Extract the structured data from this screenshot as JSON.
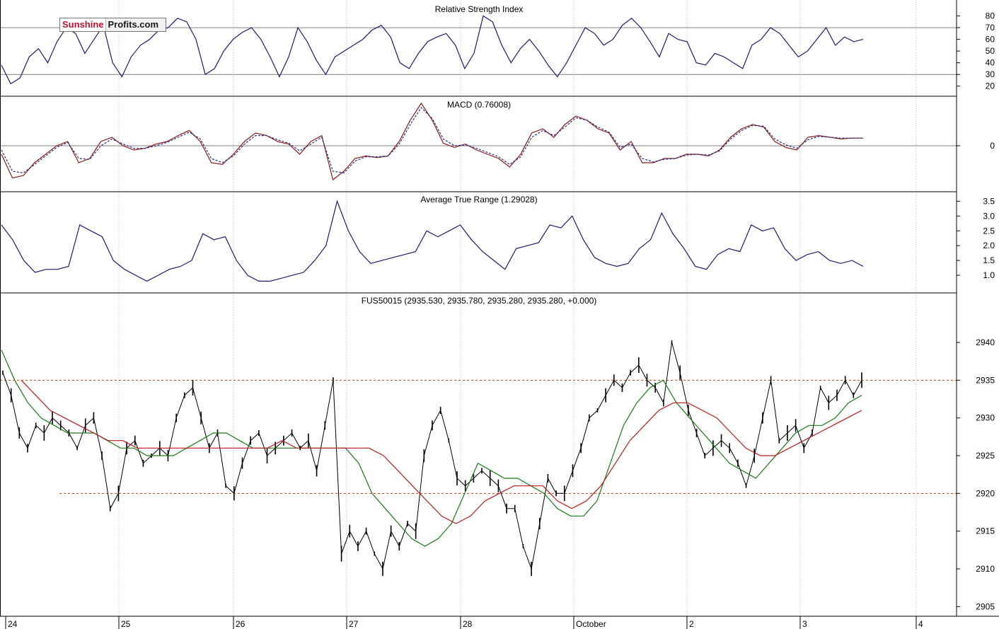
{
  "logo": {
    "part1": "Sunshine",
    "part2": "Profits.com"
  },
  "x_axis_labels": [
    "24",
    "25",
    "26",
    "27",
    "28",
    "October",
    "2",
    "3",
    "4"
  ],
  "chart_data": [
    {
      "type": "line",
      "title": "Relative Strength Index",
      "yticks": [
        "80",
        "70",
        "60",
        "50",
        "40",
        "30",
        "20"
      ],
      "ylim": [
        15,
        90
      ],
      "reference_lines": [
        30,
        70
      ],
      "series": [
        {
          "color": "#1c1c6e",
          "values": [
            38,
            22,
            27,
            45,
            52,
            40,
            58,
            70,
            65,
            48,
            60,
            72,
            40,
            28,
            45,
            55,
            60,
            68,
            70,
            78,
            75,
            60,
            30,
            35,
            50,
            60,
            66,
            70,
            60,
            45,
            28,
            45,
            70,
            58,
            42,
            30,
            45,
            50,
            55,
            60,
            68,
            72,
            62,
            40,
            35,
            48,
            58,
            62,
            65,
            55,
            35,
            48,
            80,
            75,
            55,
            40,
            52,
            60,
            50,
            38,
            28,
            40,
            55,
            70,
            65,
            55,
            60,
            72,
            78,
            70,
            58,
            45,
            65,
            60,
            58,
            40,
            38,
            48,
            45,
            40,
            35,
            55,
            60,
            70,
            65,
            55,
            45,
            50,
            60,
            70,
            55,
            62,
            58,
            60
          ]
        }
      ]
    },
    {
      "type": "line",
      "title": "MACD (0.76008)",
      "yticks": [
        "0"
      ],
      "ylim": [
        -5,
        5.5
      ],
      "series": [
        {
          "color": "#8b1a1a",
          "values": [
            -1,
            -3.8,
            -3.5,
            -2,
            -1,
            0,
            0.5,
            -2,
            -1.5,
            0.5,
            1,
            0,
            -0.5,
            -0.3,
            0.2,
            0.5,
            1.2,
            1.8,
            0.5,
            -2,
            -2.2,
            -1,
            0.5,
            1.5,
            1.2,
            0.5,
            0.2,
            -1,
            0.5,
            1.2,
            -4,
            -3,
            -1.5,
            -1.2,
            -1.4,
            -1.2,
            0.5,
            3,
            5,
            3,
            0.3,
            -0.2,
            0.2,
            -0.5,
            -1,
            -1.5,
            -2.5,
            -1,
            1.5,
            2,
            1,
            2.5,
            3.5,
            3,
            2,
            1.5,
            -0.5,
            0.5,
            -2,
            -2,
            -1.5,
            -1.5,
            -1,
            -1,
            -1.2,
            -0.5,
            1,
            2,
            2.5,
            2.2,
            0.5,
            -0.2,
            -0.5,
            1,
            1.2,
            1,
            0.8,
            0.9,
            0.9
          ]
        },
        {
          "color": "#2a2a8a",
          "values": [
            -0.5,
            -3,
            -3.2,
            -2.2,
            -1.2,
            -0.2,
            0.4,
            -1.5,
            -1.6,
            0,
            0.8,
            0.2,
            -0.3,
            -0.3,
            0,
            0.4,
            1,
            1.6,
            0.8,
            -1.5,
            -2,
            -1.2,
            0.2,
            1.2,
            1.2,
            0.7,
            0.3,
            -0.6,
            0.2,
            1,
            -3,
            -3.2,
            -1.8,
            -1.3,
            -1.3,
            -1.2,
            0.2,
            2.5,
            4.5,
            3.2,
            0.8,
            0,
            0.1,
            -0.3,
            -0.8,
            -1.3,
            -2.2,
            -1.3,
            1,
            1.8,
            1.2,
            2.2,
            3.3,
            3,
            2.2,
            1.6,
            -0.2,
            0.2,
            -1.5,
            -1.9,
            -1.6,
            -1.5,
            -1.1,
            -1,
            -1.1,
            -0.6,
            0.8,
            1.8,
            2.4,
            2.3,
            0.8,
            0.1,
            -0.3,
            0.7,
            1.1,
            1,
            0.9,
            0.9,
            0.9
          ]
        }
      ]
    },
    {
      "type": "line",
      "title": "Average True Range (1.29028)",
      "yticks": [
        "3.5",
        "3.0",
        "2.5",
        "2.0",
        "1.5",
        "1.0"
      ],
      "ylim": [
        0.5,
        3.7
      ],
      "series": [
        {
          "color": "#1c1c6e",
          "values": [
            2.7,
            2.2,
            1.5,
            1.1,
            1.2,
            1.2,
            1.3,
            2.7,
            2.5,
            2.3,
            1.5,
            1.2,
            1.0,
            0.8,
            1.0,
            1.2,
            1.3,
            1.5,
            2.4,
            2.2,
            2.3,
            1.5,
            1.0,
            0.8,
            0.8,
            0.9,
            1.0,
            1.1,
            1.5,
            2.0,
            3.5,
            2.5,
            1.8,
            1.4,
            1.5,
            1.6,
            1.7,
            1.8,
            2.5,
            2.3,
            2.5,
            2.7,
            2.2,
            1.8,
            1.5,
            1.2,
            1.9,
            2.0,
            2.1,
            2.7,
            2.6,
            3.0,
            2.2,
            1.6,
            1.4,
            1.3,
            1.4,
            1.9,
            2.2,
            3.1,
            2.4,
            1.9,
            1.3,
            1.2,
            1.7,
            1.9,
            1.8,
            2.7,
            2.5,
            2.6,
            1.9,
            1.5,
            1.7,
            1.8,
            1.5,
            1.4,
            1.5,
            1.3
          ]
        }
      ]
    },
    {
      "type": "line",
      "title": "FUS50015 (2935.530, 2935.780, 2935.280, 2935.280, +0.000)",
      "yticks": [
        "2940",
        "2935",
        "2930",
        "2925",
        "2920",
        "2915",
        "2910",
        "2905"
      ],
      "ylim": [
        2904,
        2946
      ],
      "reference_lines": [
        2935,
        2920
      ],
      "series": [
        {
          "color": "#000000",
          "values": [
            2936,
            2933,
            2928,
            2926,
            2929,
            2928,
            2930,
            2929,
            2928,
            2926,
            2929,
            2930,
            2925,
            2918,
            2920,
            2926,
            2927,
            2924,
            2925,
            2926,
            2925,
            2930,
            2933,
            2934,
            2930,
            2926,
            2928,
            2921,
            2920,
            2924,
            2927,
            2928,
            2925,
            2926,
            2927,
            2928,
            2926,
            2927,
            2923,
            2929,
            2935,
            2912,
            2915,
            2913,
            2915,
            2912,
            2910,
            2915,
            2913,
            2916,
            2915,
            2925,
            2929,
            2931,
            2927,
            2922,
            2921,
            2922,
            2923,
            2922,
            2921,
            2918,
            2918,
            2913,
            2910,
            2916,
            2922,
            2920,
            2920,
            2923,
            2926,
            2930,
            2931,
            2933,
            2935,
            2934,
            2936,
            2937,
            2935,
            2934,
            2932,
            2940,
            2936,
            2931,
            2928,
            2925,
            2926,
            2927,
            2926,
            2924,
            2921,
            2925,
            2930,
            2935,
            2927,
            2928,
            2929,
            2926,
            2928,
            2934,
            2932,
            2933,
            2935,
            2933,
            2935
          ]
        },
        {
          "color": "#1a7a1a",
          "values": [
            2939,
            2935,
            2932,
            2930,
            2929,
            2928,
            2928,
            2928,
            2927,
            2926,
            2926,
            2925,
            2925,
            2925,
            2926,
            2927,
            2928,
            2928,
            2927,
            2926,
            2926,
            2926,
            2926,
            2926,
            2926,
            2926,
            2926,
            2924,
            2920,
            2918,
            2916,
            2914,
            2913,
            2914,
            2916,
            2920,
            2924,
            2923,
            2922,
            2922,
            2921,
            2920,
            2918,
            2917,
            2917,
            2919,
            2924,
            2929,
            2932,
            2934,
            2935,
            2932,
            2930,
            2928,
            2926,
            2924,
            2923,
            2922,
            2924,
            2926,
            2928,
            2929,
            2929,
            2930,
            2932,
            2933
          ]
        },
        {
          "color": "#c0191c",
          "values": [
            2935,
            2933,
            2931,
            2930,
            2929,
            2928,
            2927,
            2927,
            2926,
            2926,
            2926,
            2926,
            2926,
            2926,
            2926,
            2926,
            2926,
            2926,
            2927,
            2926,
            2926,
            2926,
            2926,
            2926,
            2926,
            2925,
            2923,
            2921,
            2919,
            2917,
            2916,
            2917,
            2919,
            2920,
            2921,
            2921,
            2921,
            2919,
            2918,
            2919,
            2921,
            2924,
            2927,
            2929,
            2931,
            2932,
            2932,
            2931,
            2930,
            2928,
            2926,
            2925,
            2925,
            2926,
            2927,
            2928,
            2929,
            2930,
            2931
          ]
        }
      ]
    }
  ]
}
